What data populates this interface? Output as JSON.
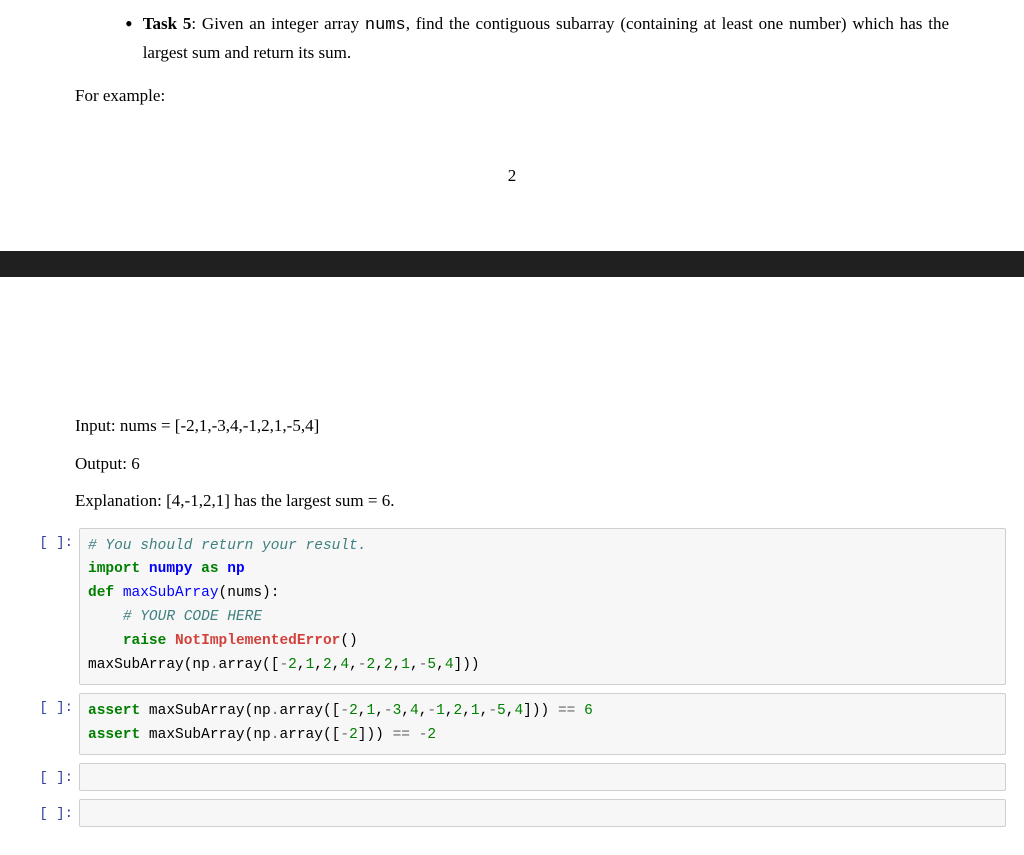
{
  "task": {
    "label": "Task 5",
    "text_before_code": ": Given an integer array ",
    "code_word": "nums",
    "text_after_code": ", find the contiguous subarray (containing at least one number) which has the largest sum and return its sum."
  },
  "for_example": "For example:",
  "page_number": "2",
  "example": {
    "input": "Input: nums = [-2,1,-3,4,-1,2,1,-5,4]",
    "output": "Output: 6",
    "explanation": "Explanation: [4,-1,2,1] has the largest sum = 6."
  },
  "cells": {
    "prompt_label": "[ ]:",
    "cell1": {
      "l1_comment": "# You should return your result.",
      "l2_import": "import",
      "l2_numpy": "numpy",
      "l2_as": "as",
      "l2_np": "np",
      "l3_def": "def",
      "l3_name": "maxSubArray",
      "l3_params": "(nums):",
      "l4_comment": "# YOUR CODE HERE",
      "l5_raise": "raise",
      "l5_err": "NotImplementedError",
      "l5_paren": "()",
      "l6_pre": "maxSubArray(np",
      "l6_dot": ".",
      "l6_arr": "array([",
      "l6_n1": "-2",
      "l6_n2": "1",
      "l6_n3": "2",
      "l6_n4": "4",
      "l6_n5": "-2",
      "l6_n6": "2",
      "l6_n7": "1",
      "l6_n8": "-5",
      "l6_n9": "4",
      "l6_end": "]))"
    },
    "cell2": {
      "l1_assert": "assert",
      "l1_call": "maxSubArray(np",
      "l1_dot": ".",
      "l1_arr": "array([",
      "l1_n1": "-2",
      "l1_n2": "1",
      "l1_n3": "-3",
      "l1_n4": "4",
      "l1_n5": "-1",
      "l1_n6": "2",
      "l1_n7": "1",
      "l1_n8": "-5",
      "l1_n9": "4",
      "l1_mid": "])) ",
      "l1_eq": "==",
      "l1_sp": " ",
      "l1_res": "6",
      "l2_assert": "assert",
      "l2_call": "maxSubArray(np",
      "l2_dot": ".",
      "l2_arr": "array([",
      "l2_n1": "-2",
      "l2_mid": "])) ",
      "l2_eq": "==",
      "l2_sp": " ",
      "l2_res": "-2"
    }
  }
}
